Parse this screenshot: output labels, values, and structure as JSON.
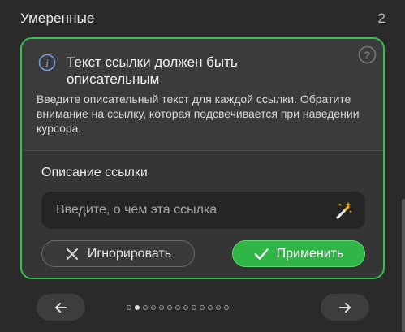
{
  "section": {
    "title": "Умеренные",
    "count": "2"
  },
  "card": {
    "info_icon": "info-icon",
    "help_icon": "question-icon",
    "title": "Текст ссылки должен быть описательным",
    "description": "Введите описательный текст для каждой ссылки. Обратите внимание на ссылку, которая подсвечивается при наведении курсора.",
    "field_label": "Описание ссылки",
    "input": {
      "value": "",
      "placeholder": "Введите, о чём эта ссылка"
    },
    "wand_icon": "magic-wand-icon",
    "ignore_label": "Игнорировать",
    "apply_label": "Применить"
  },
  "pagination": {
    "total": 13,
    "current": 2,
    "prev_icon": "arrow-left-icon",
    "next_icon": "arrow-right-icon"
  },
  "colors": {
    "accent": "#2fb646",
    "border_accent": "#35c24f",
    "background": "#2a2a2a",
    "card": "#3b3b3b"
  }
}
